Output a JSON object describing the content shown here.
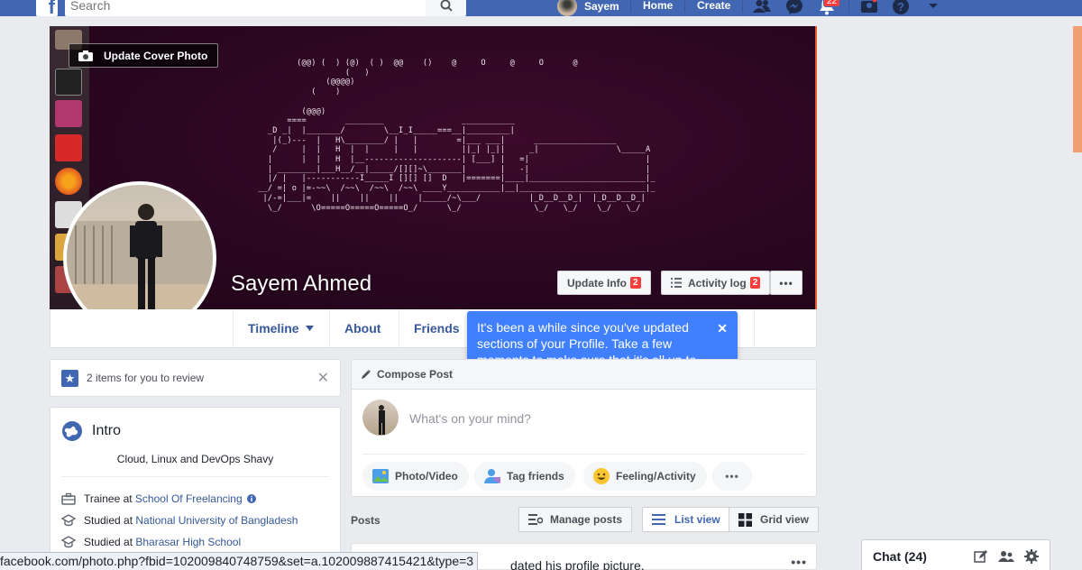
{
  "topbar": {
    "logo": "f",
    "search_placeholder": "Search",
    "user_name": "Sayem",
    "home": "Home",
    "create": "Create",
    "notifications_count": "22"
  },
  "cover": {
    "update_cover": "Update Cover Photo",
    "ascii_art": "           (@@) (  ) (@)  ( )  @@    ()    @     O     @     O      @\n                     (   )\n                 (@@@@)\n              (    )\n\n            (@@@)\n         ====        ________                ___________\n     _D _|  |_______/        \\__I_I_____===__|_________|\n      |(_)---  |   H\\________/ |   |        =|___ ___|      _________________\n      /     |  |   H  |  |     |   |         ||_| |_||     _|                \\_____A\n     |      |  |   H  |__--------------------| [___] |   =|                        |\n     | ________|___H__/__|_____/[][]~\\_______|       |   -|                        |\n     |/ |   |-----------I_____I [][] []  D   |=======|____|________________________|_\n   __/ =| o |=-~~\\  /~~\\  /~~\\  /~~\\ ____Y___________|__|__________________________|_\n    |/-=|___|=    ||    ||    ||    |_____/~\\___/          |_D__D__D_|  |_D__D__D_|\n     \\_/      \\O=====O=====O=====O_/      \\_/               \\_/   \\_/    \\_/   \\_/",
    "name": "Sayem Ahmed",
    "update_info": "Update Info",
    "update_info_badge": "2",
    "activity_log": "Activity log",
    "activity_log_badge": "2",
    "more": "•••"
  },
  "tabs": {
    "timeline": "Timeline",
    "about": "About",
    "friends": "Friends"
  },
  "tooltip": {
    "text": "It's been a while since you've updated sections of your Profile. Take a few moments to make sure that it's all up to date.",
    "close": "✕"
  },
  "review": {
    "text": "2 items for you to review",
    "close": "✕"
  },
  "intro": {
    "title": "Intro",
    "bio": "Cloud, Linux and DevOps Shavy",
    "rows": [
      {
        "prefix": "Trainee at ",
        "link": "School Of Freelancing",
        "icon": "briefcase-icon"
      },
      {
        "prefix": "Studied at ",
        "link": "National University of Bangladesh",
        "icon": "graduation-cap-icon"
      },
      {
        "prefix": "Studied at ",
        "link": "Bharasar High School",
        "icon": "graduation-cap-icon"
      }
    ]
  },
  "composer": {
    "compose_post": "Compose Post",
    "placeholder": "What's on your mind?",
    "photo_video": "Photo/Video",
    "tag_friends": "Tag friends",
    "feeling": "Feeling/Activity",
    "more": "•••"
  },
  "posts": {
    "label": "Posts",
    "manage": "Manage posts",
    "list_view": "List view",
    "grid_view": "Grid view",
    "post_text": "dated his profile picture.",
    "post_more": "•••"
  },
  "status_url": "facebook.com/photo.php?fbid=102009840748759&set=a.102009887415421&type=3",
  "chat": {
    "label": "Chat (24)"
  },
  "colors": {
    "brand": "#4267b2",
    "tooltip": "#4080ff",
    "badge": "#fa3e3e",
    "link": "#365899"
  }
}
